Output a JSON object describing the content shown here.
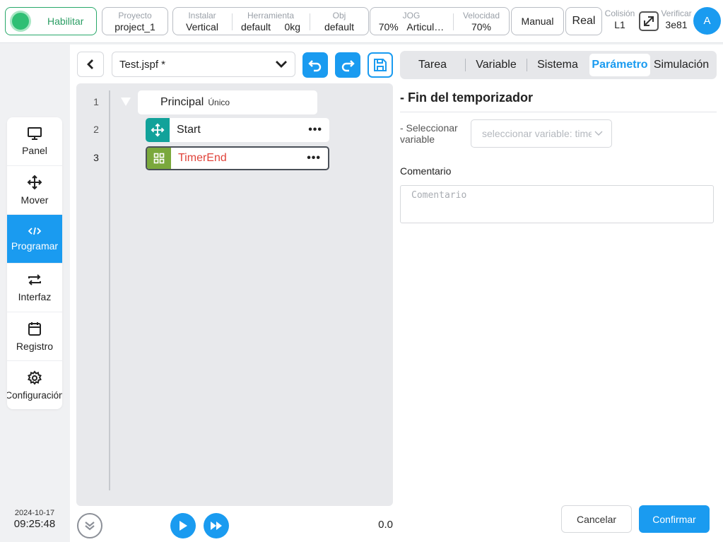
{
  "topbar": {
    "enable_label": "Habilitar",
    "project": {
      "label": "Proyecto",
      "value": "project_1"
    },
    "install": {
      "label": "Instalar",
      "value": "Vertical"
    },
    "tool": {
      "label": "Herramienta",
      "value_name": "default",
      "value_weight": "0kg"
    },
    "obj": {
      "label": "Obj",
      "value": "default"
    },
    "jog": {
      "label": "JOG",
      "value_pct": "70%",
      "value_mode": "Articul…"
    },
    "speed": {
      "label": "Velocidad",
      "value": "70%"
    },
    "mode_label": "Manual",
    "real_label": "Real",
    "collision": {
      "label": "Colisión",
      "value": "L1"
    },
    "verify": {
      "label": "Verificar",
      "value": "3e81"
    },
    "avatar_letter": "A"
  },
  "nav": [
    {
      "label": "Panel",
      "icon": "monitor-icon"
    },
    {
      "label": "Mover",
      "icon": "move-icon"
    },
    {
      "label": "Programar",
      "icon": "code-icon"
    },
    {
      "label": "Interfaz",
      "icon": "swap-icon"
    },
    {
      "label": "Registro",
      "icon": "calendar-icon"
    },
    {
      "label": "Configuración",
      "icon": "gear-icon"
    }
  ],
  "datetime": {
    "date": "2024-10-17",
    "time": "09:25:48"
  },
  "program": {
    "file_name": "Test.jspf *",
    "lines": [
      "1",
      "2",
      "3"
    ],
    "main": {
      "label": "Principal",
      "sub": "Único"
    },
    "nodes": [
      {
        "label": "Start",
        "icon": "move-icon"
      },
      {
        "label": "TimerEnd",
        "icon": "grid-icon"
      }
    ],
    "speed_value": "0.0"
  },
  "panel": {
    "tabs": [
      "Tarea",
      "Variable",
      "Sistema",
      "Parámetro",
      "Simulación"
    ],
    "active_tab": "Parámetro",
    "title": "- Fin del temporizador",
    "select_label": "- Seleccionar variable",
    "select_placeholder": "seleccionar variable: timer",
    "comment_label": "Comentario",
    "comment_placeholder": "Comentario",
    "cancel_label": "Cancelar",
    "confirm_label": "Confirmar"
  },
  "colors": {
    "accent": "#1a9bf0",
    "enable": "#2fbf74",
    "node_start": "#12a29a",
    "node_timer": "#7aa83c",
    "timer_text": "#e0433a"
  }
}
